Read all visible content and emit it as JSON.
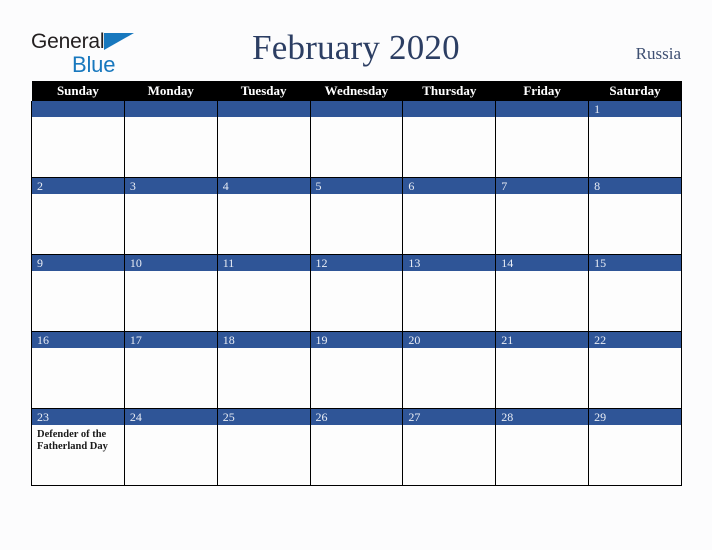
{
  "brand": {
    "line1": "General",
    "line2": "Blue",
    "triangle_color": "#1878be",
    "text_color": "#231f20"
  },
  "header": {
    "title": "February 2020",
    "country": "Russia",
    "title_color": "#2c3e63"
  },
  "calendar": {
    "weekday_headers": [
      "Sunday",
      "Monday",
      "Tuesday",
      "Wednesday",
      "Thursday",
      "Friday",
      "Saturday"
    ],
    "header_bg": "#000000",
    "header_text": "#ffffff",
    "daybar_bg": "#2f5597",
    "daybar_text": "#e9edf5",
    "cell_bg": "#fdfdfd",
    "grid_line": "#000000",
    "weeks": [
      [
        {
          "day": "",
          "event": ""
        },
        {
          "day": "",
          "event": ""
        },
        {
          "day": "",
          "event": ""
        },
        {
          "day": "",
          "event": ""
        },
        {
          "day": "",
          "event": ""
        },
        {
          "day": "",
          "event": ""
        },
        {
          "day": "1",
          "event": ""
        }
      ],
      [
        {
          "day": "2",
          "event": ""
        },
        {
          "day": "3",
          "event": ""
        },
        {
          "day": "4",
          "event": ""
        },
        {
          "day": "5",
          "event": ""
        },
        {
          "day": "6",
          "event": ""
        },
        {
          "day": "7",
          "event": ""
        },
        {
          "day": "8",
          "event": ""
        }
      ],
      [
        {
          "day": "9",
          "event": ""
        },
        {
          "day": "10",
          "event": ""
        },
        {
          "day": "11",
          "event": ""
        },
        {
          "day": "12",
          "event": ""
        },
        {
          "day": "13",
          "event": ""
        },
        {
          "day": "14",
          "event": ""
        },
        {
          "day": "15",
          "event": ""
        }
      ],
      [
        {
          "day": "16",
          "event": ""
        },
        {
          "day": "17",
          "event": ""
        },
        {
          "day": "18",
          "event": ""
        },
        {
          "day": "19",
          "event": ""
        },
        {
          "day": "20",
          "event": ""
        },
        {
          "day": "21",
          "event": ""
        },
        {
          "day": "22",
          "event": ""
        }
      ],
      [
        {
          "day": "23",
          "event": "Defender of the Fatherland Day"
        },
        {
          "day": "24",
          "event": ""
        },
        {
          "day": "25",
          "event": ""
        },
        {
          "day": "26",
          "event": ""
        },
        {
          "day": "27",
          "event": ""
        },
        {
          "day": "28",
          "event": ""
        },
        {
          "day": "29",
          "event": ""
        }
      ]
    ]
  }
}
